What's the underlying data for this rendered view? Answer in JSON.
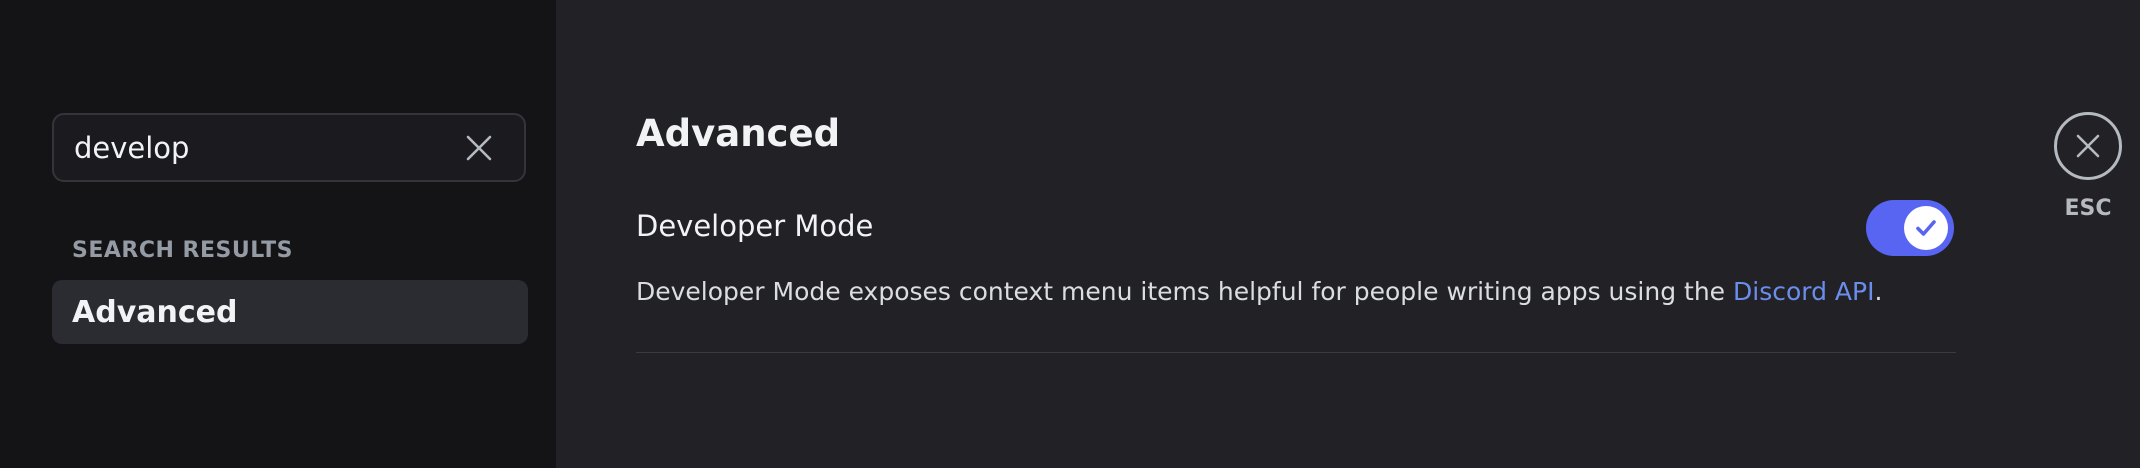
{
  "search": {
    "value": "develop",
    "clear_icon": "close-icon"
  },
  "sidebar": {
    "section_header": "SEARCH RESULTS",
    "items": [
      {
        "label": "Advanced",
        "selected": true
      }
    ]
  },
  "main": {
    "title": "Advanced",
    "setting": {
      "title": "Developer Mode",
      "enabled": true,
      "description_prefix": "Developer Mode exposes context menu items helpful for people writing apps using the ",
      "link_text": "Discord API",
      "description_suffix": "."
    }
  },
  "close": {
    "icon": "close-icon",
    "label": "ESC"
  },
  "colors": {
    "accent": "#5865f2",
    "link": "#6b8eed",
    "sidebar_bg": "#141417",
    "main_bg": "#222226"
  }
}
